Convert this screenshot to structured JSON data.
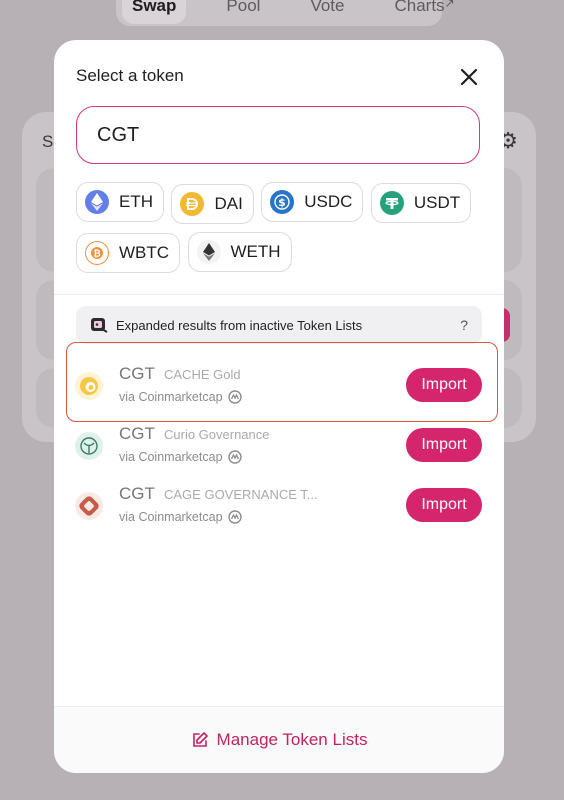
{
  "nav": {
    "tabs": [
      "Swap",
      "Pool",
      "Vote",
      "Charts"
    ],
    "charts_arrow": "↗"
  },
  "bg_card": {
    "title_letter": "S"
  },
  "modal": {
    "title": "Select a token",
    "search": {
      "value": "CGT",
      "placeholder": ""
    },
    "common_tokens": [
      {
        "symbol": "ETH",
        "color": "#627eea"
      },
      {
        "symbol": "DAI",
        "color": "#f4b731"
      },
      {
        "symbol": "USDC",
        "color": "#2775ca"
      },
      {
        "symbol": "USDT",
        "color": "#26a17b"
      },
      {
        "symbol": "WBTC",
        "color": "#f09242"
      },
      {
        "symbol": "WETH",
        "color": "#343434"
      }
    ],
    "banner": {
      "text": "Expanded results from inactive Token Lists",
      "help": "?"
    },
    "results": [
      {
        "symbol": "CGT",
        "name": "CACHE Gold",
        "source": "via Coinmarketcap",
        "action": "Import",
        "highlighted": true
      },
      {
        "symbol": "CGT",
        "name": "Curio Governance",
        "source": "via Coinmarketcap",
        "action": "Import",
        "highlighted": false
      },
      {
        "symbol": "CGT",
        "name": "CAGE GOVERNANCE T...",
        "source": "via Coinmarketcap",
        "action": "Import",
        "highlighted": false
      }
    ],
    "footer": {
      "manage_label": "Manage Token Lists"
    }
  },
  "colors": {
    "accent": "#d5256c",
    "highlight_border": "#d9573f"
  }
}
